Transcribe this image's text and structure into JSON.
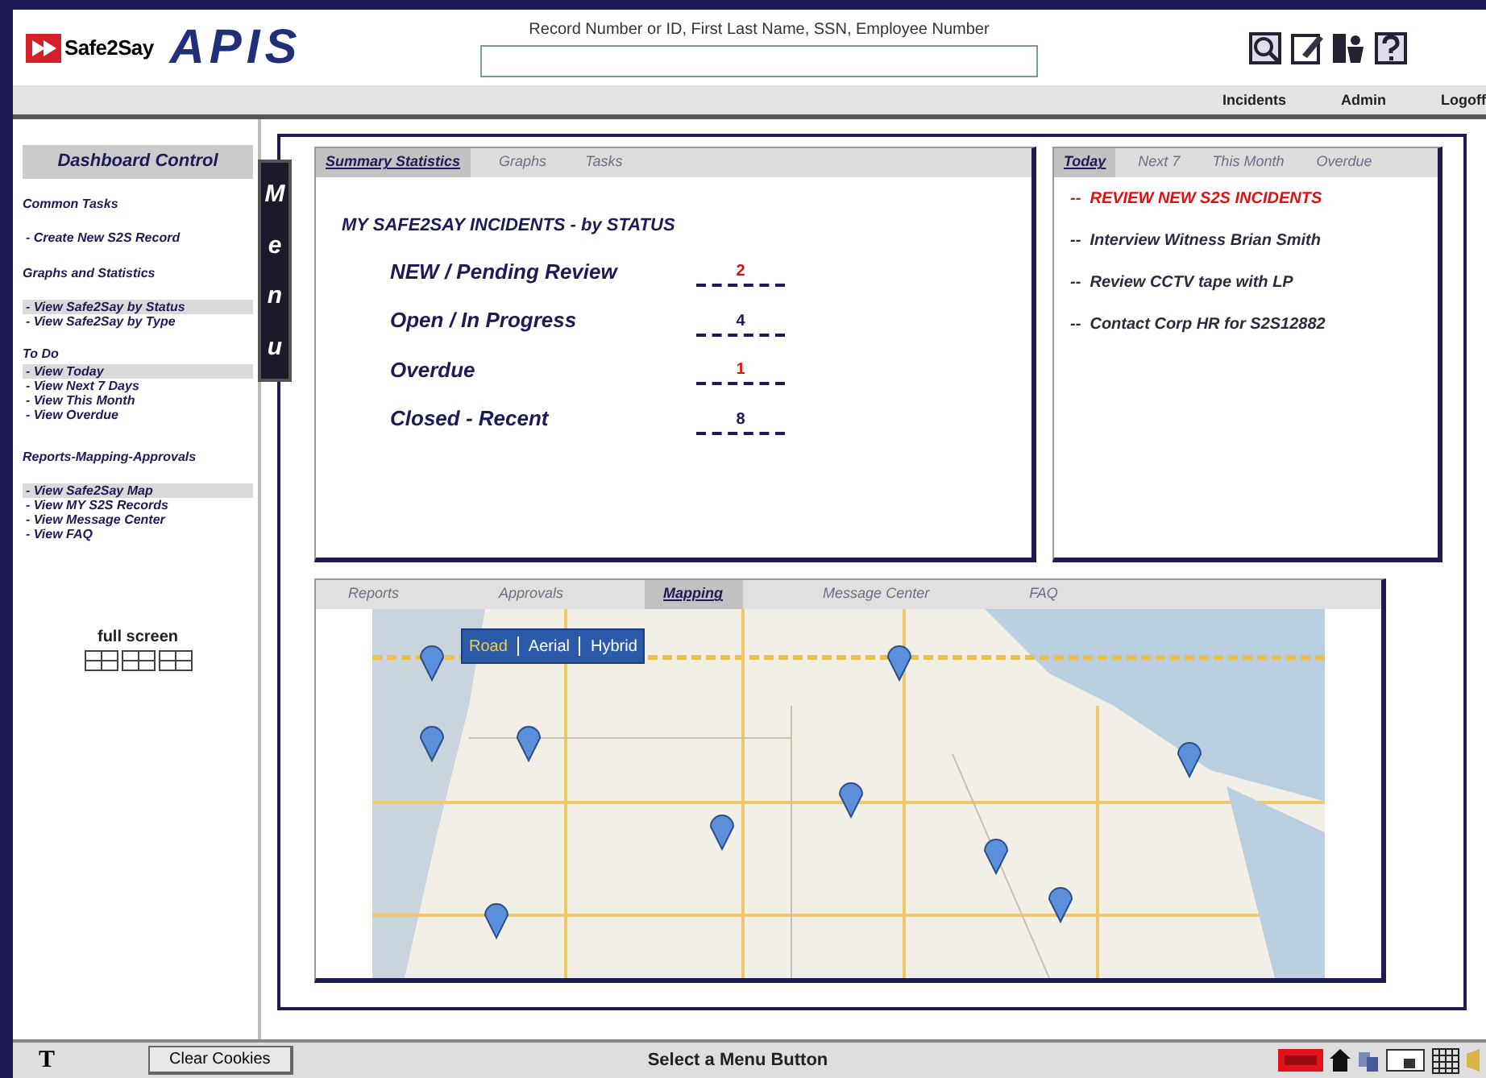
{
  "header": {
    "logo_text": "Safe2Say",
    "app_name": "APIS",
    "search": {
      "label": "Record Number or ID, First Last Name, SSN, Employee Number"
    },
    "nav": [
      {
        "label": "Incidents"
      },
      {
        "label": "Admin"
      },
      {
        "label": "Logoff"
      }
    ]
  },
  "sidebar": {
    "title": "Dashboard Control",
    "groups": [
      {
        "heading": "Common Tasks",
        "items": [
          {
            "label": "- Create New S2S Record",
            "selected": false
          }
        ]
      },
      {
        "heading": "Graphs and Statistics",
        "items": [
          {
            "label": "- View Safe2Say by Status",
            "selected": true
          },
          {
            "label": "- View Safe2Say by Type",
            "selected": false
          }
        ]
      },
      {
        "heading": "To Do",
        "items": [
          {
            "label": "- View Today",
            "selected": true
          },
          {
            "label": "- View Next 7 Days",
            "selected": false
          },
          {
            "label": "- View This Month",
            "selected": false
          },
          {
            "label": "- View Overdue",
            "selected": false
          }
        ]
      },
      {
        "heading": "Reports-Mapping-Approvals",
        "items": [
          {
            "label": "- View Safe2Say Map",
            "selected": true
          },
          {
            "label": "- View MY S2S Records",
            "selected": false
          },
          {
            "label": "- View Message Center",
            "selected": false
          },
          {
            "label": "- View FAQ",
            "selected": false
          }
        ]
      }
    ],
    "full_screen": "full screen"
  },
  "menu_tab": "Menu",
  "summary": {
    "tabs": [
      {
        "label": "Summary Statistics",
        "selected": true
      },
      {
        "label": "Graphs",
        "selected": false
      },
      {
        "label": "Tasks",
        "selected": false
      }
    ],
    "title": "MY  SAFE2SAY INCIDENTS - by STATUS",
    "rows": [
      {
        "label": "NEW / Pending Review",
        "count": "2",
        "alert": true
      },
      {
        "label": "Open / In Progress",
        "count": "4",
        "alert": false
      },
      {
        "label": "Overdue",
        "count": "1",
        "alert": true
      },
      {
        "label": "Closed - Recent",
        "count": "8",
        "alert": false
      }
    ]
  },
  "todo": {
    "tabs": [
      {
        "label": "Today",
        "selected": true
      },
      {
        "label": "Next 7",
        "selected": false
      },
      {
        "label": "This Month",
        "selected": false
      },
      {
        "label": "Overdue",
        "selected": false
      }
    ],
    "items": [
      {
        "text": "--  REVIEW NEW S2S INCIDENTS",
        "urgent": true
      },
      {
        "text": "--  Interview Witness Brian Smith",
        "urgent": false
      },
      {
        "text": "--  Review CCTV tape with LP",
        "urgent": false
      },
      {
        "text": "--  Contact Corp HR for S2S12882",
        "urgent": false
      }
    ]
  },
  "map_panel": {
    "tabs": [
      {
        "label": "Reports",
        "selected": false
      },
      {
        "label": "Approvals",
        "selected": false
      },
      {
        "label": "Mapping",
        "selected": true
      },
      {
        "label": "Message Center",
        "selected": false
      },
      {
        "label": "FAQ",
        "selected": false
      }
    ],
    "map_types": [
      {
        "label": "Road",
        "selected": true
      },
      {
        "label": "Aerial",
        "selected": false
      },
      {
        "label": "Hybrid",
        "selected": false
      }
    ]
  },
  "status_bar": {
    "font_key": "T",
    "clear_button": "Clear Cookies",
    "message": "Select a Menu Button"
  }
}
